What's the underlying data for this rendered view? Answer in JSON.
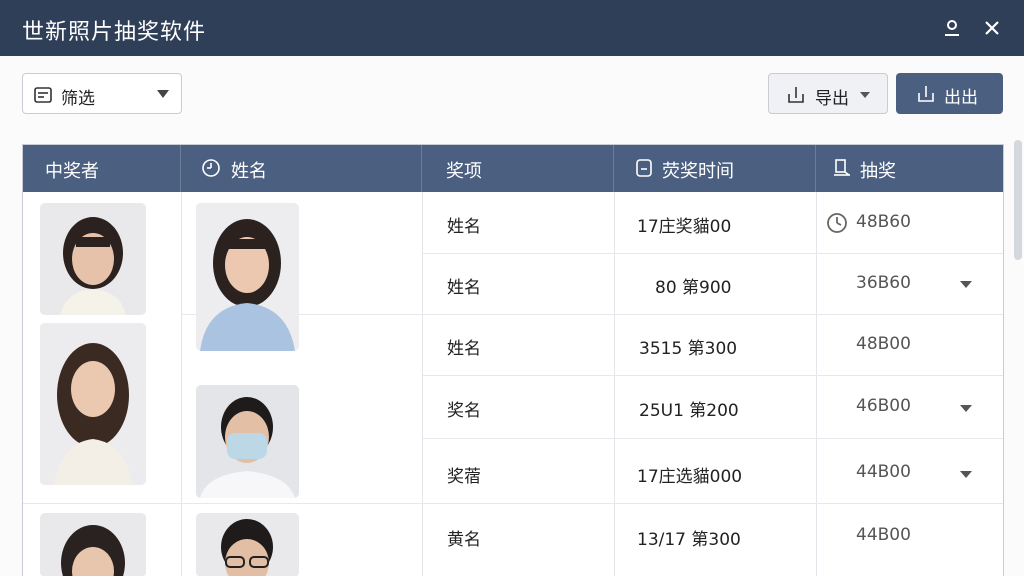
{
  "window": {
    "title": "世新照片抽奖软件",
    "user_icon": "user-icon",
    "close_icon": "close-icon"
  },
  "toolbar": {
    "filter_label": "筛选",
    "export_label": "导出",
    "out_label": "出出"
  },
  "table": {
    "headers": [
      {
        "label": "中奖者",
        "icon": ""
      },
      {
        "label": "姓名",
        "icon": "clock-icon"
      },
      {
        "label": "奖项",
        "icon": ""
      },
      {
        "label": "荧奖时间",
        "icon": "document-icon"
      },
      {
        "label": "抽奖",
        "icon": "bookmark-icon"
      }
    ],
    "rows": [
      {
        "prize": "姓名",
        "time": "17庄奖貓00",
        "draw": "48B60"
      },
      {
        "prize": "姓名",
        "time": "80 第900",
        "draw": "36B60"
      },
      {
        "prize": "姓名",
        "time": "3515 第300",
        "draw": "48B00"
      },
      {
        "prize": "奖名",
        "time": "25U1 第200",
        "draw": "46B00"
      },
      {
        "prize": "奖蓿",
        "time": "17庄选貓000",
        "draw": "44B00"
      },
      {
        "prize": "黄名",
        "time": "13/17 第300",
        "draw": "44B00"
      }
    ]
  },
  "colors": {
    "titlebar": "#2f3f58",
    "header": "#4b5f80",
    "primary_button": "#4b5f80"
  }
}
